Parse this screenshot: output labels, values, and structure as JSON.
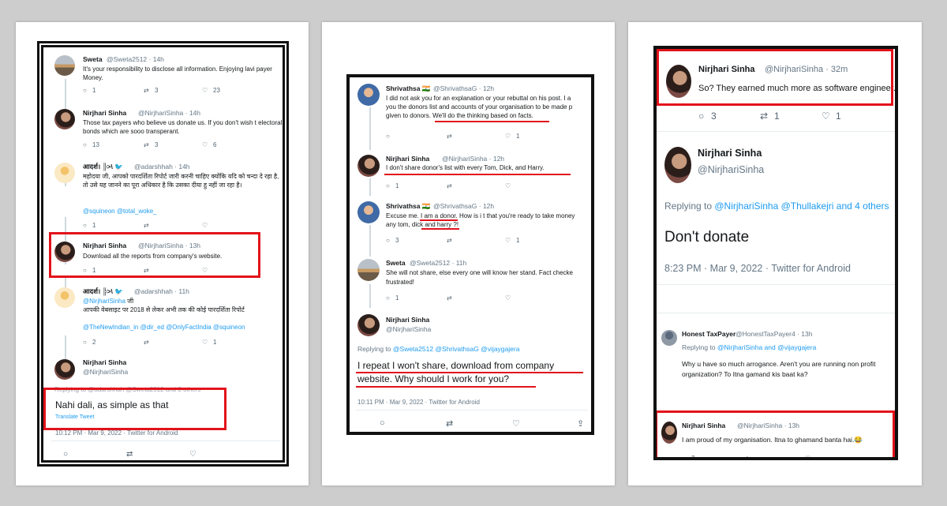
{
  "panel1": {
    "t1": {
      "name": "Sweta",
      "handle": "@Sweta2512 · 14h",
      "text": "It's your responsibility to disclose all information. Enjoying lavi payer Money.",
      "reply": "1",
      "rt": "3",
      "like": "23"
    },
    "t2": {
      "name": "Nirjhari Sinha",
      "handle": "@NirjhariSinha · 14h",
      "text": "Those tax payers who believe us donate us. If you don't wish t electoral bonds which are sooo transperant.",
      "reply": "13",
      "rt": "3",
      "like": "6"
    },
    "t3": {
      "name": "आदर्श। ╠>\\ 🐦",
      "handle": "@adarshhah · 14h",
      "text": "महोदया जी, आपको पारदर्शिता रिपोर्ट जारी करनी चाहिए क्योंकि यदि को चन्दा दे रहा है, तो उसे यह जानने का पूरा अधिकार है कि उसका दीया हु नहीं जा रहा है।",
      "links": "@squineon @total_woke_",
      "reply": "1",
      "rt": "",
      "like": ""
    },
    "t4": {
      "name": "Nirjhari Sinha",
      "handle": "@NirjhariSinha · 13h",
      "text": "Download all the reports from company's website.",
      "reply": "1",
      "rt": "",
      "like": ""
    },
    "t5": {
      "name": "आदर्श। ╠>\\ 🐦",
      "handle": "@adarshhah · 11h",
      "text_pre": "@NirjhariSinha",
      "text_pre2": " जी",
      "text": "आपकी वेबसाइट पर 2018 से लेकर अभी तक की कोई पारदर्शिता रिपोर्ट",
      "links": "@TheNewIndian_in @dir_ed @OnlyFactIndia @squineon",
      "reply": "2",
      "rt": "",
      "like": "1"
    },
    "main": {
      "name": "Nirjhari Sinha",
      "handle": "@NirjhariSinha",
      "replying": "Replying to @adarshhah @Sweta2512 and 3 others",
      "text": "Nahi dali, as simple as that",
      "translate": "Translate Tweet",
      "meta": "10:12 PM · Mar 9, 2022 · Twitter for Android"
    }
  },
  "panel2": {
    "t1": {
      "name": "Shrivathsa",
      "handle": "@ShrivathsaG · 12h",
      "text_a": "I did not ask you for an explanation or your rebuttal on his post. I a",
      "text_b": "you the donors list and accounts of your organisation to be made p",
      "text_c": "given to donors.",
      "text_c2": " We'll do the thinking based on facts.",
      "reply": "",
      "rt": "",
      "like": "1"
    },
    "t2": {
      "name": "Nirjhari Sinha",
      "handle": "@NirjhariSinha · 12h",
      "text": "I don't share donor's list with  every Tom, Dick, and Harry.",
      "reply": "1",
      "rt": "",
      "like": ""
    },
    "t3": {
      "name": "Shrivathsa",
      "handle": "@ShrivathsaG · 12h",
      "text_a": "Excuse me.",
      "text_a2": " I am a donor.",
      "text_a3": " How is i t that you're ready to take money",
      "text_b": "any tom, dick and harry ?!",
      "reply": "3",
      "rt": "",
      "like": "1"
    },
    "t4": {
      "name": "Sweta",
      "handle": "@Sweta2512 · 11h",
      "text": "She will not share, else every one will know her stand. Fact checke frustrated!",
      "reply": "1",
      "rt": "",
      "like": ""
    },
    "main": {
      "name": "Nirjhari Sinha",
      "handle": "@NirjhariSinha",
      "replying_pre": "Replying to ",
      "replying_links": "@Sweta2512 @ShrivathsaG @vijaygajera",
      "text": "I repeat I won't share, download from company website. Why should I work for you?",
      "meta": "10:11 PM · Mar 9, 2022 · Twitter for Android"
    }
  },
  "panel3": {
    "t1": {
      "name": "Nirjhari Sinha",
      "handle": "@NirjhariSinha · 32m",
      "text": "So? They earned much more as software engineer.",
      "reply": "3",
      "rt": "1",
      "like": "1"
    },
    "main": {
      "name": "Nirjhari Sinha",
      "handle": "@NirjhariSinha",
      "replying_pre": "Replying to ",
      "replying_links": "@NirjhariSinha @Thullakejri and 4 others",
      "text": "Don't donate",
      "meta": "8:23 PM · Mar 9, 2022 · Twitter for Android"
    },
    "t2": {
      "name": "Honest TaxPayer",
      "handle": "@HonestTaxPayer4 · 13h",
      "replying_pre": "Replying to ",
      "replying_links": "@NirjhariSinha and @vijaygajera",
      "text": "Why u have so much arrogance. Aren't you are running non profit organization? To Itna gamand kis baat ka?"
    },
    "t3": {
      "name": "Nirjhari Sinha",
      "handle": "@NirjhariSinha · 13h",
      "text": "I am proud of my organisation. Itna to ghamand banta hai.😂",
      "reply": "2",
      "rt": "",
      "like": ""
    }
  },
  "icons": {
    "reply": "○",
    "retweet": "⇄",
    "like": "♡",
    "share": "⇪"
  }
}
